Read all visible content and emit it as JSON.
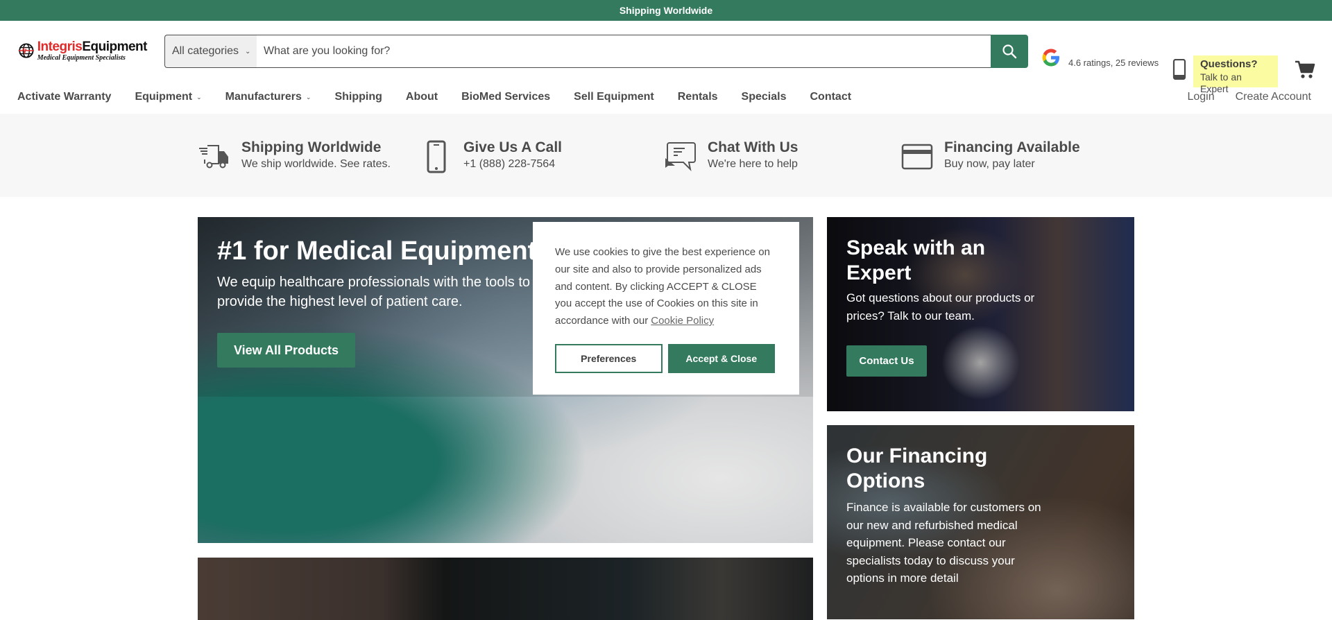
{
  "announcement": {
    "text": "Shipping Worldwide"
  },
  "header": {
    "logo": {
      "brand_red": "Integris",
      "brand_black": "Equipment",
      "tagline": "Medical Equipment Specialists"
    },
    "search": {
      "category_label": "All categories",
      "placeholder": "What are you looking for?",
      "value": ""
    },
    "google_rating": {
      "text": "4.6 ratings, 25 reviews",
      "rating": 4.6,
      "reviews": 25
    },
    "questions": {
      "title": "Questions?",
      "subtitle": "Talk to an Expert"
    }
  },
  "nav": {
    "items": [
      {
        "label": "Activate Warranty",
        "dropdown": false
      },
      {
        "label": "Equipment",
        "dropdown": true
      },
      {
        "label": "Manufacturers",
        "dropdown": true
      },
      {
        "label": "Shipping",
        "dropdown": false
      },
      {
        "label": "About",
        "dropdown": false
      },
      {
        "label": "BioMed Services",
        "dropdown": false
      },
      {
        "label": "Sell Equipment",
        "dropdown": false
      },
      {
        "label": "Rentals",
        "dropdown": false
      },
      {
        "label": "Specials",
        "dropdown": false
      },
      {
        "label": "Contact",
        "dropdown": false
      }
    ],
    "login": "Login",
    "create_account": "Create Account"
  },
  "features": [
    {
      "icon": "truck-icon",
      "title": "Shipping Worldwide",
      "subtitle": "We ship worldwide. See rates."
    },
    {
      "icon": "phone-icon",
      "title": "Give Us A Call",
      "subtitle": "+1 (888) 228-7564"
    },
    {
      "icon": "chat-icon",
      "title": "Chat With Us",
      "subtitle": "We're here to help"
    },
    {
      "icon": "credit-card-icon",
      "title": "Financing Available",
      "subtitle": "Buy now, pay later"
    }
  ],
  "hero": {
    "title": "#1 for Medical Equipment",
    "subtitle": "We equip healthcare professionals with the tools to provide the highest level of patient care.",
    "button": "View All Products"
  },
  "cards": [
    {
      "title": "Speak with an Expert",
      "text": "Got questions about our products or prices? Talk to our team.",
      "button": "Contact Us"
    },
    {
      "title": "Our Financing Options",
      "text": "Finance is available for customers on our new and refurbished medical equipment. Please contact our specialists today to discuss your options in more detail"
    }
  ],
  "cookie_banner": {
    "text": "We use cookies to give the best experience on our site and also to provide personalized ads and content. By clicking ACCEPT & CLOSE you accept the use of Cookies on this site in accordance with our",
    "link": "Cookie Policy",
    "preferences": "Preferences",
    "accept": "Accept & Close"
  },
  "colors": {
    "brand_green": "#337a5e",
    "highlight_yellow": "#fbfba1",
    "logo_red": "#e02b2b",
    "text_gray": "#4a4a4a"
  }
}
